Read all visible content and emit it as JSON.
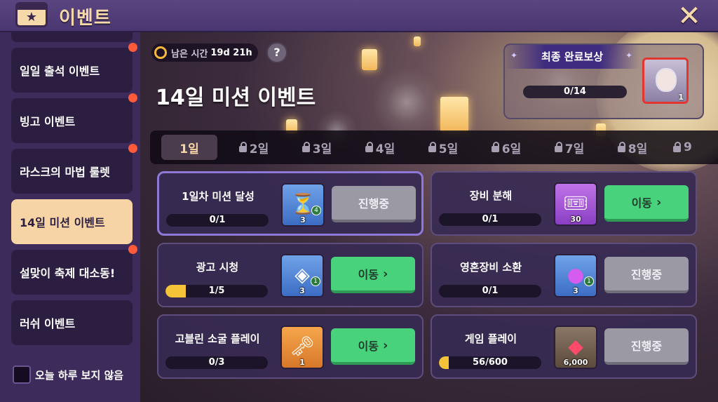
{
  "header": {
    "title": "이벤트",
    "close_icon": "close-icon"
  },
  "sidebar": {
    "items": [
      {
        "label": "일일 출석 이벤트",
        "active": false,
        "notify": true
      },
      {
        "label": "빙고 이벤트",
        "active": false,
        "notify": true
      },
      {
        "label": "라스크의 마법 룰렛",
        "active": false,
        "notify": true
      },
      {
        "label": "14일 미션 이벤트",
        "active": true,
        "notify": false
      },
      {
        "label": "설맞이 축제 대소동!",
        "active": false,
        "notify": true
      },
      {
        "label": "러쉬 이벤트",
        "active": false,
        "notify": false
      }
    ],
    "hide_today_label": "오늘 하루 보지 않음"
  },
  "event": {
    "timer_label": "남은 시간",
    "timer_value": "19d 21h",
    "help_label": "?",
    "title": "14일 미션 이벤트"
  },
  "final_reward": {
    "title": "최종 완료보상",
    "progress": "0/14",
    "reward_count": "1"
  },
  "tabs": [
    {
      "label": "1일",
      "locked": false,
      "active": true
    },
    {
      "label": "2일",
      "locked": true
    },
    {
      "label": "3일",
      "locked": true
    },
    {
      "label": "4일",
      "locked": true
    },
    {
      "label": "5일",
      "locked": true
    },
    {
      "label": "6일",
      "locked": true
    },
    {
      "label": "7일",
      "locked": true
    },
    {
      "label": "8일",
      "locked": true
    },
    {
      "label": "9",
      "locked": true
    }
  ],
  "missions": [
    {
      "name": "1일차 미션 달성",
      "progress": "0/1",
      "progress_fraction": 0,
      "reward_icon": "hourglass-icon",
      "reward_qty": "3",
      "reward_badge": "4",
      "button": "진행중",
      "button_state": "in-progress"
    },
    {
      "name": "장비 분해",
      "progress": "0/1",
      "progress_fraction": 0,
      "reward_icon": "ticket-icon",
      "reward_qty": "30",
      "reward_badge": "",
      "button": "이동",
      "button_state": "go"
    },
    {
      "name": "광고 시청",
      "progress": "1/5",
      "progress_fraction": 0.2,
      "reward_icon": "crystal-icon",
      "reward_qty": "3",
      "reward_badge": "1",
      "button": "이동",
      "button_state": "go"
    },
    {
      "name": "영혼장비 소환",
      "progress": "0/1",
      "progress_fraction": 0,
      "reward_icon": "orb-icon",
      "reward_qty": "3",
      "reward_badge": "1",
      "button": "진행중",
      "button_state": "in-progress"
    },
    {
      "name": "고블린 소굴 플레이",
      "progress": "0/3",
      "progress_fraction": 0,
      "reward_icon": "key-icon",
      "reward_qty": "1",
      "reward_badge": "",
      "button": "이동",
      "button_state": "go"
    },
    {
      "name": "게임 플레이",
      "progress": "56/600",
      "progress_fraction": 0.0933,
      "reward_icon": "gem-icon",
      "reward_qty": "6,000",
      "reward_badge": "",
      "button": "진행중",
      "button_state": "in-progress"
    }
  ],
  "colors": {
    "accent": "#f7d4a6",
    "go_button": "#49d27c",
    "progress_fill": "#f4c338",
    "notify_dot": "#ff5a3a"
  }
}
